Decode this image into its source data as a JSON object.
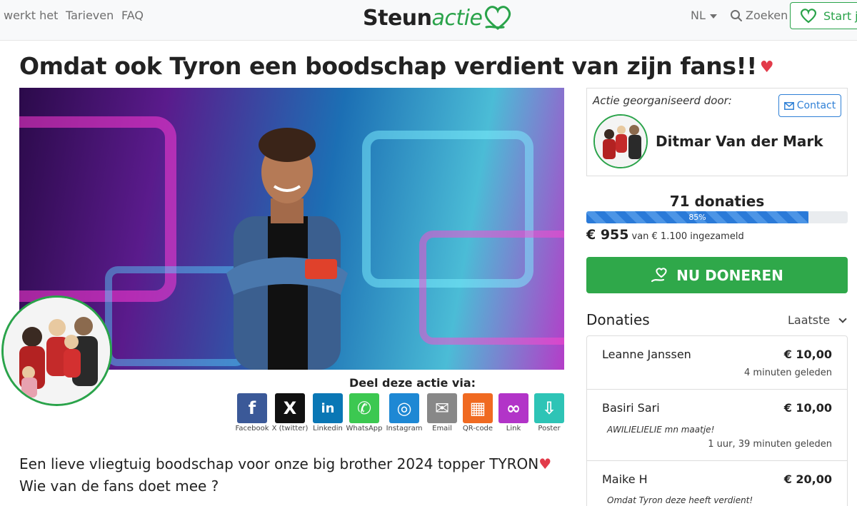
{
  "nav": {
    "links": [
      "werkt het",
      "Tarieven",
      "FAQ"
    ],
    "logo_main": "Steun",
    "logo_accent": "actie",
    "language": "NL",
    "search_label": "Zoeken",
    "start_label": "Start j"
  },
  "campaign": {
    "title": "Omdat ook Tyron een boodschap verdient van zijn fans!!",
    "share_title": "Deel deze actie via:",
    "share": [
      {
        "label": "Facebook",
        "icon": "facebook-icon",
        "color": "#3b5998",
        "glyph": "f"
      },
      {
        "label": "X (twitter)",
        "icon": "x-icon",
        "color": "#111111",
        "glyph": "X"
      },
      {
        "label": "Linkedin",
        "icon": "linkedin-icon",
        "color": "#0a77b5",
        "glyph": "in"
      },
      {
        "label": "WhatsApp",
        "icon": "whatsapp-icon",
        "color": "#3cc851",
        "glyph": "✆"
      },
      {
        "label": "Instagram",
        "icon": "instagram-icon",
        "color": "#1e88d4",
        "glyph": "◎"
      },
      {
        "label": "Email",
        "icon": "email-icon",
        "color": "#888888",
        "glyph": "✉"
      },
      {
        "label": "QR-code",
        "icon": "qr-code-icon",
        "color": "#f06a21",
        "glyph": "▦"
      },
      {
        "label": "Link",
        "icon": "link-icon",
        "color": "#b234c8",
        "glyph": "∞"
      },
      {
        "label": "Poster",
        "icon": "poster-icon",
        "color": "#2ec4b6",
        "glyph": "⇩"
      }
    ],
    "description_line1": "Een lieve vliegtuig boodschap voor onze big brother 2024 topper TYRON",
    "description_line2": "Wie van de fans doet mee ?"
  },
  "organizer": {
    "label": "Actie georganiseerd door:",
    "contact_label": "Contact",
    "name": "Ditmar Van der Mark"
  },
  "stats": {
    "donations_count": "71 donaties",
    "progress_label": "85%",
    "progress_fraction": 0.85,
    "raised": "€ 955",
    "raised_detail": "van € 1.100 ingezameld",
    "donate_label": "NU DONEREN"
  },
  "donations": {
    "header": "Donaties",
    "sort_label": "Laatste",
    "items": [
      {
        "name": "Leanne Janssen",
        "amount": "€ 10,00",
        "message": "",
        "time": "4 minuten geleden"
      },
      {
        "name": "Basiri Sari",
        "amount": "€ 10,00",
        "message": "AWILIELIELIE mn maatje!",
        "time": "1 uur, 39 minuten geleden"
      },
      {
        "name": "Maike H",
        "amount": "€ 20,00",
        "message": "Omdat Tyron deze heeft verdient!",
        "time": ""
      }
    ]
  },
  "colors": {
    "brand_green": "#2aa34a",
    "accent_blue": "#2f80d6",
    "heart_red": "#e23b4a"
  }
}
